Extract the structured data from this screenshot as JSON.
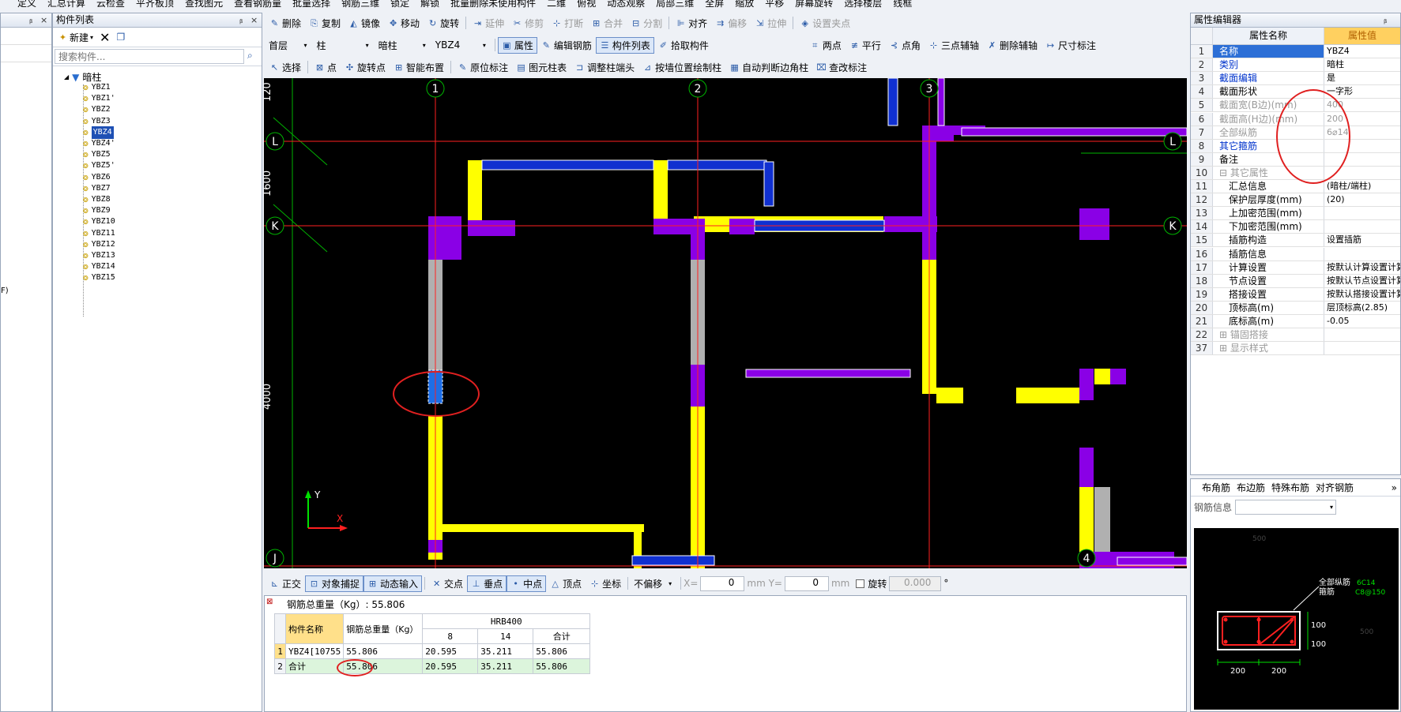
{
  "menubar": [
    "定义",
    "汇总计算",
    "云检查",
    "平齐板顶",
    "查找图元",
    "查看钢筋量",
    "批量选择",
    "钢筋三维",
    "锁定",
    "解锁",
    "批量删除未使用构件",
    "二维",
    "俯视",
    "动态观察",
    "局部三维",
    "全屏",
    "缩放",
    "平移",
    "屏幕旋转",
    "选择楼层",
    "线框"
  ],
  "left_panel": {
    "title": "构件列表",
    "new_label": "新建",
    "search_placeholder": "搜索构件...",
    "root": "暗柱",
    "items": [
      "YBZ1",
      "YBZ1'",
      "YBZ2",
      "YBZ3",
      "YBZ4",
      "YBZ4'",
      "YBZ5",
      "YBZ5'",
      "YBZ6",
      "YBZ7",
      "YBZ8",
      "YBZ9",
      "YBZ10",
      "YBZ11",
      "YBZ12",
      "YBZ13",
      "YBZ14",
      "YBZ15"
    ],
    "selected": "YBZ4",
    "edge_text": "F)"
  },
  "toolbar1": [
    "删除",
    "复制",
    "镜像",
    "移动",
    "旋转",
    "延伸",
    "修剪",
    "打断",
    "合并",
    "分割",
    "对齐",
    "偏移",
    "拉伸",
    "设置夹点"
  ],
  "toolbar2": {
    "floor": "首层",
    "type": "柱",
    "subtype": "暗柱",
    "component": "YBZ4",
    "buttons": [
      "属性",
      "编辑钢筋",
      "构件列表",
      "拾取构件",
      "两点",
      "平行",
      "点角",
      "三点辅轴",
      "删除辅轴",
      "尺寸标注"
    ]
  },
  "toolbar3": [
    "选择",
    "点",
    "旋转点",
    "智能布置",
    "原位标注",
    "图元柱表",
    "调整柱端头",
    "按墙位置绘制柱",
    "自动判断边角柱",
    "查改标注"
  ],
  "canvas": {
    "axes_v": [
      "1",
      "2",
      "3",
      "4"
    ],
    "axes_h": [
      "L",
      "K",
      "J"
    ],
    "dims": [
      "120",
      "1600",
      "4000"
    ],
    "y_label": "Y",
    "x_label": "X"
  },
  "status_bar": {
    "items": [
      "正交",
      "对象捕捉",
      "动态输入",
      "交点",
      "垂点",
      "中点",
      "顶点",
      "坐标"
    ],
    "offset_mode": "不偏移",
    "x_label": "X=",
    "x_val": "0",
    "y_label": "mm Y=",
    "y_val": "0",
    "mm": "mm",
    "rotate_label": "旋转",
    "rotate_val": "0.000",
    "deg": "°"
  },
  "rebar": {
    "total_label": "钢筋总重量（Kg）: 55.806",
    "headers": [
      "构件名称",
      "钢筋总重量（Kg）",
      "HRB400",
      "8",
      "14",
      "合计"
    ],
    "rows": [
      {
        "no": "1",
        "name": "YBZ4[10755",
        "total": "55.806",
        "d8": "20.595",
        "d14": "35.211",
        "sum": "55.806"
      },
      {
        "no": "2",
        "name": "合计",
        "total": "55.806",
        "d8": "20.595",
        "d14": "35.211",
        "sum": "55.806"
      }
    ]
  },
  "props": {
    "title": "属性编辑器",
    "col_name": "属性名称",
    "col_value": "属性值",
    "rows": [
      {
        "no": "1",
        "k": "名称",
        "v": "YBZ4",
        "style": "blue"
      },
      {
        "no": "2",
        "k": "类别",
        "v": "暗柱",
        "style": "blue"
      },
      {
        "no": "3",
        "k": "截面编辑",
        "v": "是",
        "style": "blue"
      },
      {
        "no": "4",
        "k": "截面形状",
        "v": "一字形",
        "style": ""
      },
      {
        "no": "5",
        "k": "截面宽(B边)(mm)",
        "v": "400",
        "style": "gray"
      },
      {
        "no": "6",
        "k": "截面高(H边)(mm)",
        "v": "200",
        "style": "gray"
      },
      {
        "no": "7",
        "k": "全部纵筋",
        "v": "6⌀14",
        "style": "gray"
      },
      {
        "no": "8",
        "k": "其它箍筋",
        "v": "",
        "style": "blue"
      },
      {
        "no": "9",
        "k": "备注",
        "v": "",
        "style": ""
      },
      {
        "no": "10",
        "k": "⊟ 其它属性",
        "v": "",
        "style": "gray"
      },
      {
        "no": "11",
        "k": "　汇总信息",
        "v": "(暗柱/端柱)",
        "style": ""
      },
      {
        "no": "12",
        "k": "　保护层厚度(mm)",
        "v": "(20)",
        "style": ""
      },
      {
        "no": "13",
        "k": "　上加密范围(mm)",
        "v": "",
        "style": ""
      },
      {
        "no": "14",
        "k": "　下加密范围(mm)",
        "v": "",
        "style": ""
      },
      {
        "no": "15",
        "k": "　插筋构造",
        "v": "设置插筋",
        "style": ""
      },
      {
        "no": "16",
        "k": "　插筋信息",
        "v": "",
        "style": ""
      },
      {
        "no": "17",
        "k": "　计算设置",
        "v": "按默认计算设置计算",
        "style": ""
      },
      {
        "no": "18",
        "k": "　节点设置",
        "v": "按默认节点设置计算",
        "style": ""
      },
      {
        "no": "19",
        "k": "　搭接设置",
        "v": "按默认搭接设置计算",
        "style": ""
      },
      {
        "no": "20",
        "k": "　顶标高(m)",
        "v": "层顶标高(2.85)",
        "style": ""
      },
      {
        "no": "21",
        "k": "　底标高(m)",
        "v": "-0.05",
        "style": ""
      },
      {
        "no": "22",
        "k": "⊞ 锚固搭接",
        "v": "",
        "style": "gray"
      },
      {
        "no": "37",
        "k": "⊞ 显示样式",
        "v": "",
        "style": "gray"
      }
    ]
  },
  "section": {
    "tabs": [
      "布角筋",
      "布边筋",
      "特殊布筋",
      "对齐钢筋"
    ],
    "info_label": "钢筋信息",
    "annot": [
      "全部纵筋",
      "箍筋",
      "6C14",
      "C8@150"
    ],
    "dims": [
      "200",
      "200",
      "100",
      "100",
      "500",
      "500"
    ]
  },
  "colors": {
    "wall": "#ffff00",
    "column": "#8a00e6",
    "beam": "#1030d0",
    "axis": "#ff2020",
    "aux": "#00c000",
    "canvas": "#000000",
    "highlight": "#1e6ee6",
    "annotation": "#e02020"
  }
}
